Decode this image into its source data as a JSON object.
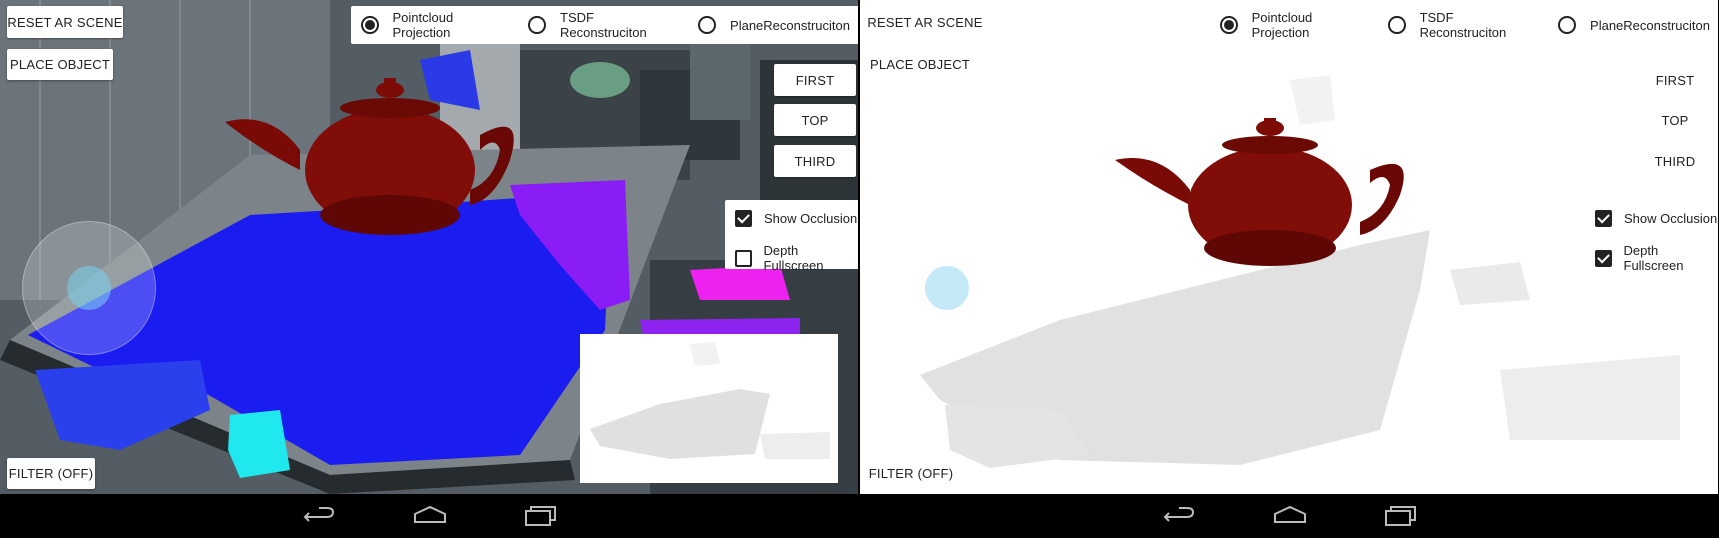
{
  "panels": [
    {
      "id": "left",
      "reset_label": "RESET AR SCENE",
      "place_label": "PLACE OBJECT",
      "filter_label": "FILTER (OFF)",
      "radios": [
        {
          "label": "Pointcloud Projection",
          "selected": true
        },
        {
          "label": "TSDF Reconstruciton",
          "selected": false
        },
        {
          "label": "PlaneReconstruciton",
          "selected": false
        }
      ],
      "camera_buttons": [
        "FIRST",
        "TOP",
        "THIRD"
      ],
      "checks": [
        {
          "label": "Show Occlusion",
          "checked": true
        },
        {
          "label": "Depth Fullscreen",
          "checked": false
        }
      ]
    },
    {
      "id": "right",
      "reset_label": "RESET AR SCENE",
      "place_label": "PLACE OBJECT",
      "filter_label": "FILTER (OFF)",
      "radios": [
        {
          "label": "Pointcloud Projection",
          "selected": true
        },
        {
          "label": "TSDF Reconstruciton",
          "selected": false
        },
        {
          "label": "PlaneReconstruciton",
          "selected": false
        }
      ],
      "camera_buttons": [
        "FIRST",
        "TOP",
        "THIRD"
      ],
      "checks": [
        {
          "label": "Show Occlusion",
          "checked": true
        },
        {
          "label": "Depth Fullscreen",
          "checked": true
        }
      ]
    }
  ],
  "colors": {
    "teapot": "#7a0a06",
    "pointcloud_blue": "#1a1cf0",
    "pointcloud_violet": "#8a1cf5",
    "pointcloud_magenta": "#ee22f0",
    "pointcloud_cyan": "#1fe8ee",
    "depth_gray": "#e2e2e2",
    "joystick_accent": "#78d2f0"
  },
  "icons": [
    "back-icon",
    "home-icon",
    "recents-icon",
    "joystick-icon"
  ]
}
